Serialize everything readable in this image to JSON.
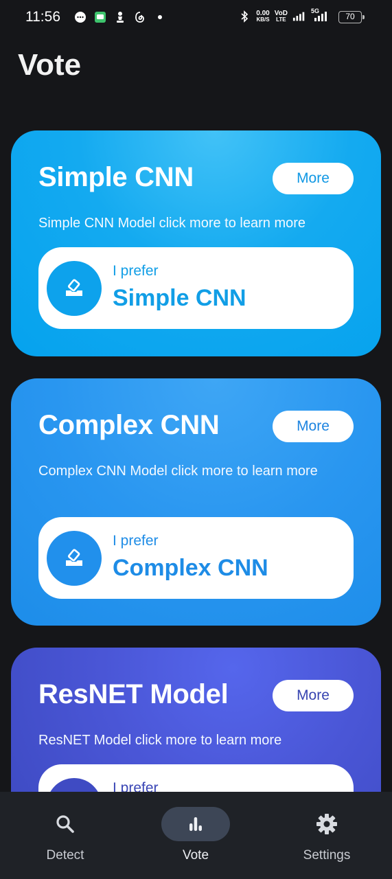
{
  "status_bar": {
    "time": "11:56",
    "net_speed_value": "0.00",
    "net_speed_unit": "KB/S",
    "volte_top": "VoD",
    "volte_bottom": "LTE",
    "signal2_label": "5G",
    "battery": "70"
  },
  "page": {
    "title": "Vote"
  },
  "cards": [
    {
      "title": "Simple CNN",
      "more_label": "More",
      "description": "Simple CNN Model click more to learn more",
      "prefer_label": "I prefer",
      "prefer_model": "Simple CNN"
    },
    {
      "title": "Complex CNN",
      "more_label": "More",
      "description": "Complex CNN Model click more to learn more",
      "prefer_label": "I prefer",
      "prefer_model": "Complex CNN"
    },
    {
      "title": "ResNET Model",
      "more_label": "More",
      "description": "ResNET Model click more to learn more",
      "prefer_label": "I prefer",
      "prefer_model": ""
    }
  ],
  "bottom_nav": {
    "items": [
      {
        "label": "Detect",
        "icon": "search-icon"
      },
      {
        "label": "Vote",
        "icon": "bar-chart-icon",
        "selected": true
      },
      {
        "label": "Settings",
        "icon": "gear-icon"
      }
    ]
  },
  "colors": {
    "background": "#151619",
    "card_1": "#05a2ee",
    "card_2": "#1d8de9",
    "card_3": "#4a56d6",
    "nav_bg": "#1f2227",
    "nav_selected_pill": "#3d4656"
  }
}
